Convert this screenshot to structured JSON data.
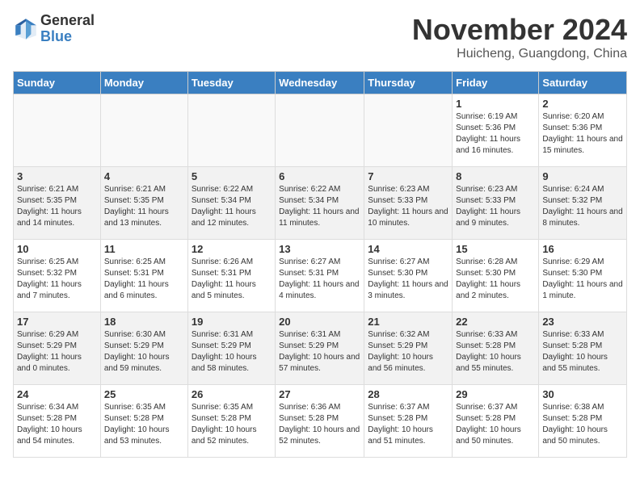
{
  "logo": {
    "general": "General",
    "blue": "Blue"
  },
  "header": {
    "month": "November 2024",
    "location": "Huicheng, Guangdong, China"
  },
  "days_of_week": [
    "Sunday",
    "Monday",
    "Tuesday",
    "Wednesday",
    "Thursday",
    "Friday",
    "Saturday"
  ],
  "weeks": [
    [
      {
        "day": "",
        "info": ""
      },
      {
        "day": "",
        "info": ""
      },
      {
        "day": "",
        "info": ""
      },
      {
        "day": "",
        "info": ""
      },
      {
        "day": "",
        "info": ""
      },
      {
        "day": "1",
        "info": "Sunrise: 6:19 AM\nSunset: 5:36 PM\nDaylight: 11 hours and 16 minutes."
      },
      {
        "day": "2",
        "info": "Sunrise: 6:20 AM\nSunset: 5:36 PM\nDaylight: 11 hours and 15 minutes."
      }
    ],
    [
      {
        "day": "3",
        "info": "Sunrise: 6:21 AM\nSunset: 5:35 PM\nDaylight: 11 hours and 14 minutes."
      },
      {
        "day": "4",
        "info": "Sunrise: 6:21 AM\nSunset: 5:35 PM\nDaylight: 11 hours and 13 minutes."
      },
      {
        "day": "5",
        "info": "Sunrise: 6:22 AM\nSunset: 5:34 PM\nDaylight: 11 hours and 12 minutes."
      },
      {
        "day": "6",
        "info": "Sunrise: 6:22 AM\nSunset: 5:34 PM\nDaylight: 11 hours and 11 minutes."
      },
      {
        "day": "7",
        "info": "Sunrise: 6:23 AM\nSunset: 5:33 PM\nDaylight: 11 hours and 10 minutes."
      },
      {
        "day": "8",
        "info": "Sunrise: 6:23 AM\nSunset: 5:33 PM\nDaylight: 11 hours and 9 minutes."
      },
      {
        "day": "9",
        "info": "Sunrise: 6:24 AM\nSunset: 5:32 PM\nDaylight: 11 hours and 8 minutes."
      }
    ],
    [
      {
        "day": "10",
        "info": "Sunrise: 6:25 AM\nSunset: 5:32 PM\nDaylight: 11 hours and 7 minutes."
      },
      {
        "day": "11",
        "info": "Sunrise: 6:25 AM\nSunset: 5:31 PM\nDaylight: 11 hours and 6 minutes."
      },
      {
        "day": "12",
        "info": "Sunrise: 6:26 AM\nSunset: 5:31 PM\nDaylight: 11 hours and 5 minutes."
      },
      {
        "day": "13",
        "info": "Sunrise: 6:27 AM\nSunset: 5:31 PM\nDaylight: 11 hours and 4 minutes."
      },
      {
        "day": "14",
        "info": "Sunrise: 6:27 AM\nSunset: 5:30 PM\nDaylight: 11 hours and 3 minutes."
      },
      {
        "day": "15",
        "info": "Sunrise: 6:28 AM\nSunset: 5:30 PM\nDaylight: 11 hours and 2 minutes."
      },
      {
        "day": "16",
        "info": "Sunrise: 6:29 AM\nSunset: 5:30 PM\nDaylight: 11 hours and 1 minute."
      }
    ],
    [
      {
        "day": "17",
        "info": "Sunrise: 6:29 AM\nSunset: 5:29 PM\nDaylight: 11 hours and 0 minutes."
      },
      {
        "day": "18",
        "info": "Sunrise: 6:30 AM\nSunset: 5:29 PM\nDaylight: 10 hours and 59 minutes."
      },
      {
        "day": "19",
        "info": "Sunrise: 6:31 AM\nSunset: 5:29 PM\nDaylight: 10 hours and 58 minutes."
      },
      {
        "day": "20",
        "info": "Sunrise: 6:31 AM\nSunset: 5:29 PM\nDaylight: 10 hours and 57 minutes."
      },
      {
        "day": "21",
        "info": "Sunrise: 6:32 AM\nSunset: 5:29 PM\nDaylight: 10 hours and 56 minutes."
      },
      {
        "day": "22",
        "info": "Sunrise: 6:33 AM\nSunset: 5:28 PM\nDaylight: 10 hours and 55 minutes."
      },
      {
        "day": "23",
        "info": "Sunrise: 6:33 AM\nSunset: 5:28 PM\nDaylight: 10 hours and 55 minutes."
      }
    ],
    [
      {
        "day": "24",
        "info": "Sunrise: 6:34 AM\nSunset: 5:28 PM\nDaylight: 10 hours and 54 minutes."
      },
      {
        "day": "25",
        "info": "Sunrise: 6:35 AM\nSunset: 5:28 PM\nDaylight: 10 hours and 53 minutes."
      },
      {
        "day": "26",
        "info": "Sunrise: 6:35 AM\nSunset: 5:28 PM\nDaylight: 10 hours and 52 minutes."
      },
      {
        "day": "27",
        "info": "Sunrise: 6:36 AM\nSunset: 5:28 PM\nDaylight: 10 hours and 52 minutes."
      },
      {
        "day": "28",
        "info": "Sunrise: 6:37 AM\nSunset: 5:28 PM\nDaylight: 10 hours and 51 minutes."
      },
      {
        "day": "29",
        "info": "Sunrise: 6:37 AM\nSunset: 5:28 PM\nDaylight: 10 hours and 50 minutes."
      },
      {
        "day": "30",
        "info": "Sunrise: 6:38 AM\nSunset: 5:28 PM\nDaylight: 10 hours and 50 minutes."
      }
    ]
  ]
}
